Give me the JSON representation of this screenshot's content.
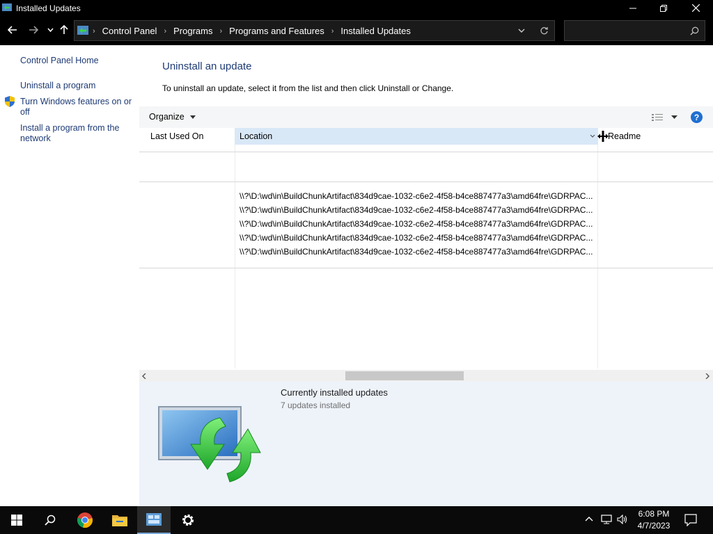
{
  "window": {
    "title": "Installed Updates",
    "minimize_icon": "minimize-icon",
    "maximize_icon": "restore-icon",
    "close_icon": "close-icon"
  },
  "address_bar": {
    "breadcrumbs": [
      "Control Panel",
      "Programs",
      "Programs and Features",
      "Installed Updates"
    ],
    "search_placeholder": ""
  },
  "left_panel": {
    "home_link": "Control Panel Home",
    "uninstall_link": "Uninstall a program",
    "features_link": "Turn Windows features on or off",
    "install_link": "Install a program from the network"
  },
  "main": {
    "heading": "Uninstall an update",
    "description": "To uninstall an update, select it from the list and then click Uninstall or Change.",
    "organize_label": "Organize",
    "columns": [
      "Last Used On",
      "Location",
      "Readme"
    ],
    "rows": [
      {
        "location": "\\\\?\\D:\\wd\\in\\BuildChunkArtifact\\834d9cae-1032-c6e2-4f58-b4ce887477a3\\amd64fre\\GDRPAC..."
      },
      {
        "location": "\\\\?\\D:\\wd\\in\\BuildChunkArtifact\\834d9cae-1032-c6e2-4f58-b4ce887477a3\\amd64fre\\GDRPAC..."
      },
      {
        "location": "\\\\?\\D:\\wd\\in\\BuildChunkArtifact\\834d9cae-1032-c6e2-4f58-b4ce887477a3\\amd64fre\\GDRPAC..."
      },
      {
        "location": "\\\\?\\D:\\wd\\in\\BuildChunkArtifact\\834d9cae-1032-c6e2-4f58-b4ce887477a3\\amd64fre\\GDRPAC..."
      },
      {
        "location": "\\\\?\\D:\\wd\\in\\BuildChunkArtifact\\834d9cae-1032-c6e2-4f58-b4ce887477a3\\amd64fre\\GDRPAC..."
      }
    ]
  },
  "details": {
    "title": "Currently installed updates",
    "count": "7 updates installed"
  },
  "taskbar": {
    "time": "6:08 PM",
    "date": "4/7/2023"
  },
  "colors": {
    "link": "#1e3b75",
    "selected_header": "#d9e8f7",
    "details_bg": "#eef3fa",
    "help_blue": "#1f6fd1"
  }
}
